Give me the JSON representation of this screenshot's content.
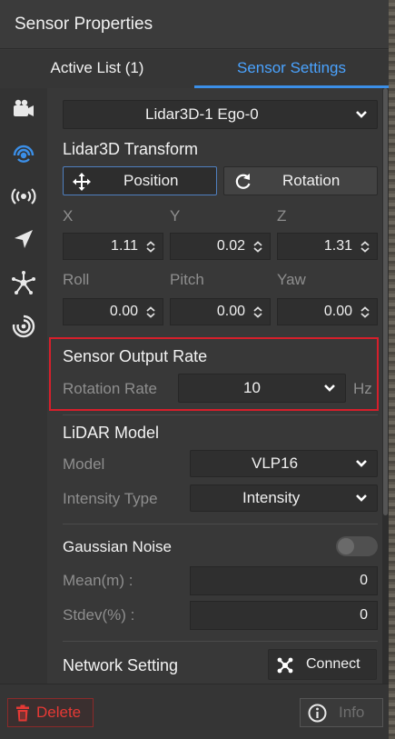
{
  "panel": {
    "title": "Sensor Properties"
  },
  "tabs": [
    {
      "label": "Active List  (1)",
      "active": false
    },
    {
      "label": "Sensor Settings",
      "active": true
    }
  ],
  "sidebar": {
    "icons": [
      "camera-icon",
      "radar-signal-icon",
      "broadcast-icon",
      "navigation-arrow-icon",
      "node-graph-icon",
      "target-radar-icon"
    ]
  },
  "sensor_select": {
    "value": "Lidar3D-1   Ego-0"
  },
  "transform": {
    "title": "Lidar3D Transform",
    "position_label": "Position",
    "rotation_label": "Rotation",
    "xyz_labels": [
      "X",
      "Y",
      "Z"
    ],
    "xyz_values": [
      "1.11",
      "0.02",
      "1.31"
    ],
    "rpy_labels": [
      "Roll",
      "Pitch",
      "Yaw"
    ],
    "rpy_values": [
      "0.00",
      "0.00",
      "0.00"
    ]
  },
  "output_rate": {
    "title": "Sensor Output Rate",
    "rotation_rate_label": "Rotation Rate",
    "rotation_rate_value": "10",
    "unit": "Hz"
  },
  "lidar_model": {
    "title": "LiDAR Model",
    "model_label": "Model",
    "model_value": "VLP16",
    "intensity_label": "Intensity Type",
    "intensity_value": "Intensity"
  },
  "noise": {
    "title": "Gaussian Noise",
    "enabled": false,
    "mean_label": "Mean(m) :",
    "mean_value": "0",
    "stdev_label": "Stdev(%) :",
    "stdev_value": "0"
  },
  "network": {
    "title": "Network Setting",
    "connect_label": "Connect"
  },
  "footer": {
    "delete_label": "Delete",
    "info_label": "Info"
  },
  "colors": {
    "accent": "#3b8fe8",
    "highlight_border": "#d61f2b",
    "delete_red": "#e53935"
  }
}
